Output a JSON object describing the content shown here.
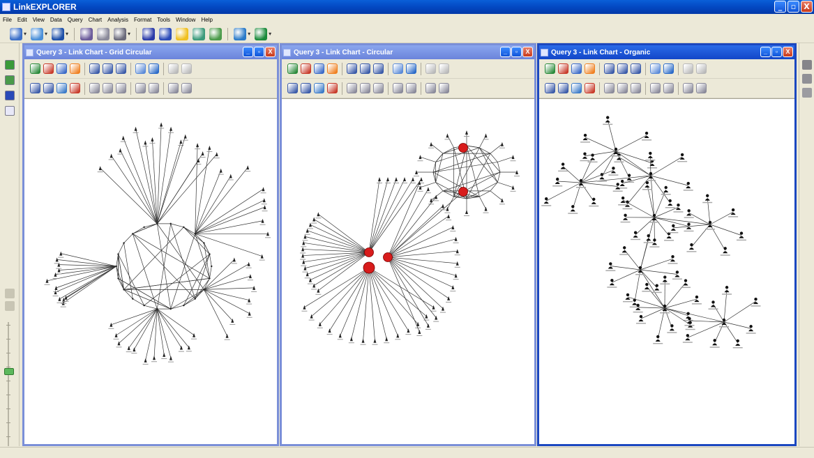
{
  "app": {
    "title": "LinkEXPLORER",
    "window_buttons": [
      "_",
      "▫",
      "X"
    ]
  },
  "menu": [
    "File",
    "Edit",
    "View",
    "Data",
    "Query",
    "Chart",
    "Analysis",
    "Format",
    "Tools",
    "Window",
    "Help"
  ],
  "main_toolbar": [
    {
      "icon": "new-query-icon",
      "color": "#3a6ec8",
      "dropdown": true
    },
    {
      "icon": "open-query-icon",
      "color": "#4a8fd8",
      "dropdown": true
    },
    {
      "icon": "save-icon",
      "color": "#1d4fa8",
      "dropdown": true
    },
    {
      "icon": "database-icon",
      "color": "#6a5a9a",
      "dropdown": false
    },
    {
      "icon": "report-icon",
      "color": "#8a8a9a",
      "dropdown": false
    },
    {
      "icon": "print-icon",
      "color": "#6a6a7a",
      "dropdown": true
    },
    {
      "icon": "help-icon",
      "color": "#2a3aa8",
      "dropdown": false
    },
    {
      "icon": "context-help-icon",
      "color": "#2a4ab8",
      "dropdown": false
    },
    {
      "icon": "smiley-icon",
      "color": "#f0c020",
      "dropdown": false
    },
    {
      "icon": "table-icon",
      "color": "#3a9a7a",
      "dropdown": false
    },
    {
      "icon": "export-icon",
      "color": "#4a9a4a",
      "dropdown": false
    },
    {
      "icon": "web-icon",
      "color": "#2a7ac8",
      "dropdown": true
    },
    {
      "icon": "globe-icon",
      "color": "#1a8a3a",
      "dropdown": true
    }
  ],
  "child_windows": [
    {
      "title": "Query 3 - Link Chart - Grid Circular",
      "active": false,
      "layout": "grid-circular"
    },
    {
      "title": "Query 3 - Link Chart - Circular",
      "active": false,
      "layout": "circular"
    },
    {
      "title": "Query 3 - Link Chart - Organic",
      "active": true,
      "layout": "organic"
    }
  ],
  "chart_toolbar_row1": [
    {
      "icon": "zoom-in-icon",
      "color": "#2a8a3a"
    },
    {
      "icon": "zoom-out-icon",
      "color": "#c83a2a"
    },
    {
      "icon": "fit-window-icon",
      "color": "#3a6ac8"
    },
    {
      "icon": "highlight-icon",
      "color": "#f08020"
    },
    {
      "icon": "layout-grid-icon",
      "color": "#3a5aa8"
    },
    {
      "icon": "layout-box-icon",
      "color": "#3a5aa8"
    },
    {
      "icon": "layout-frame-icon",
      "color": "#3a5aa8"
    },
    {
      "icon": "network-icon",
      "color": "#5a8ad8"
    },
    {
      "icon": "refresh-icon",
      "color": "#2a6ac8"
    },
    {
      "icon": "copy-disabled-icon",
      "color": "#b8b8b8"
    },
    {
      "icon": "undo-disabled-icon",
      "color": "#b8b8b8"
    }
  ],
  "chart_toolbar_row2": [
    {
      "icon": "arrange-up-icon",
      "color": "#3a5aa8"
    },
    {
      "icon": "arrange-down-icon",
      "color": "#3a5aa8"
    },
    {
      "icon": "add-node-icon",
      "color": "#3a7ac8"
    },
    {
      "icon": "color-fill-icon",
      "color": "#c83a2a"
    },
    {
      "icon": "link-split-icon",
      "color": "#8a8a9a"
    },
    {
      "icon": "link-merge-icon",
      "color": "#8a8a9a"
    },
    {
      "icon": "align-icon",
      "color": "#8a8a9a"
    },
    {
      "icon": "distribute-icon",
      "color": "#8a8a9a"
    },
    {
      "icon": "hierarchy-icon",
      "color": "#8a8a9a"
    },
    {
      "icon": "spread-icon",
      "color": "#8a8a9a"
    },
    {
      "icon": "chevron-icon",
      "color": "#8a8a9a"
    }
  ],
  "left_rail_icons": [
    {
      "icon": "arrow-green-icon",
      "color": "#3a9a3a"
    },
    {
      "icon": "pencil-chart-icon",
      "color": "#4a9a4a"
    },
    {
      "icon": "help-book-icon",
      "color": "#2a4ab8"
    },
    {
      "icon": "page-icon",
      "color": "#e8e8f8"
    }
  ],
  "right_rail_icons": [
    {
      "icon": "link-tool-icon",
      "color": "#5a5a6a"
    },
    {
      "icon": "filter-image-icon",
      "color": "#6a6a7a"
    },
    {
      "icon": "funnel-icon",
      "color": "#7a7a8a"
    }
  ]
}
